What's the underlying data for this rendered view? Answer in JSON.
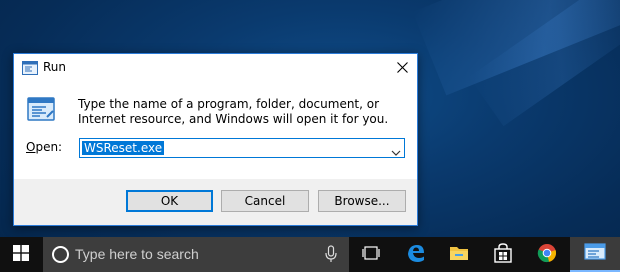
{
  "dialog": {
    "title": "Run",
    "description": "Type the name of a program, folder, document, or Internet resource, and Windows will open it for you.",
    "open_label_underlined": "O",
    "open_label_rest": "pen:",
    "open_value": "WSReset.exe",
    "buttons": {
      "ok": "OK",
      "cancel": "Cancel",
      "browse": "Browse..."
    }
  },
  "taskbar": {
    "search_placeholder": "Type here to search",
    "icons": [
      "windows-start-icon",
      "cortana-search-icon",
      "microphone-icon",
      "task-view-icon",
      "edge-icon",
      "file-explorer-icon",
      "store-icon",
      "chrome-icon",
      "run-app-icon"
    ]
  },
  "colors": {
    "accent": "#0078d7",
    "taskbar": "#101010",
    "search_box": "#3d3d3d"
  }
}
